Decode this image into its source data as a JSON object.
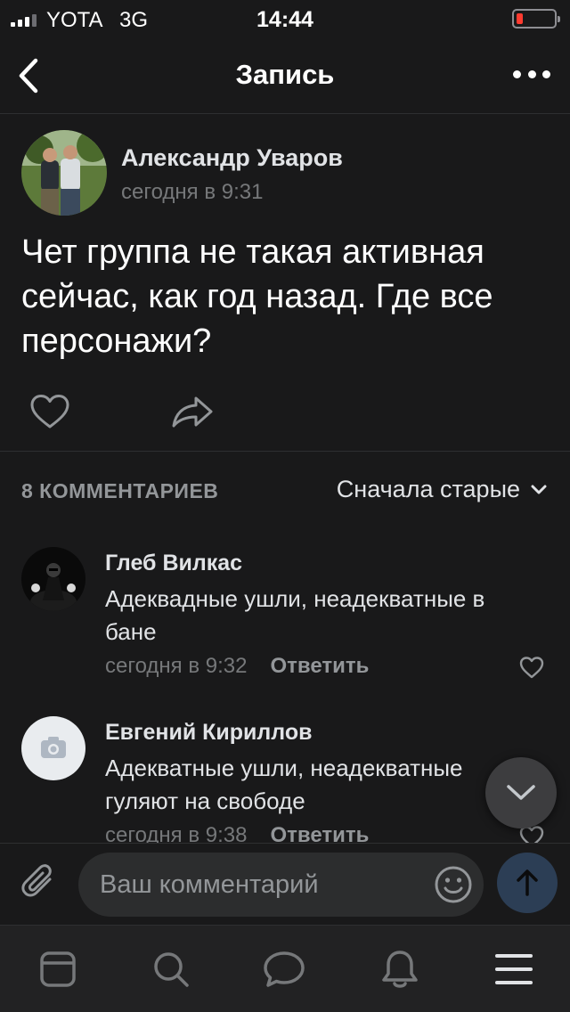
{
  "status_bar": {
    "carrier": "YOTA",
    "network": "3G",
    "time": "14:44",
    "battery_level": 0.1,
    "battery_color": "#ff3b30"
  },
  "nav": {
    "title": "Запись",
    "back_icon": "chevron-left-icon",
    "more_icon": "more-horizontal-icon"
  },
  "post": {
    "author": "Александр Уваров",
    "time": "сегодня в 9:31",
    "text": "Чет группа не такая активная сейчас, как год назад. Где все персонажи?",
    "like_icon": "heart-icon",
    "share_icon": "share-icon"
  },
  "comments_header": {
    "count_label": "8 КОММЕНТАРИЕВ",
    "sort_label": "Сначала старые"
  },
  "comments": [
    {
      "author": "Глеб Вилкас",
      "text": "Адеквадные ушли, неадекватные в бане",
      "time": "сегодня в 9:32",
      "reply_label": "Ответить"
    },
    {
      "author": "Евгений Кириллов",
      "text": "Адекватные ушли, неадекватные гуляют на свободе",
      "time": "сегодня в 9:38",
      "reply_label": "Ответить"
    }
  ],
  "composer": {
    "placeholder": "Ваш комментарий",
    "accent": "#2c3e55"
  },
  "tabbar": {
    "items": [
      "news-icon",
      "search-icon",
      "messages-icon",
      "notifications-icon",
      "menu-icon"
    ]
  }
}
